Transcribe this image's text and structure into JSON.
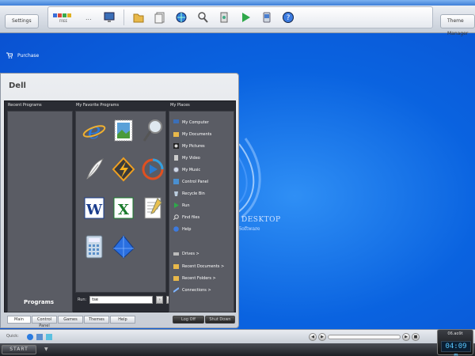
{
  "top": {
    "settings": "Settings",
    "theme_manager": "Theme Manager",
    "dots": "...",
    "tray_caption": "FREE"
  },
  "purchase": "Purchase",
  "desktop": {
    "logo_title": "DESKTOP",
    "logo_sub": "Software"
  },
  "menu": {
    "title": "Dell",
    "recent_header": "Recent Programs",
    "fav_header": "My Favorite Programs",
    "places_header": "My Places",
    "programs_label": "Programs",
    "run_label": "Run:",
    "run_value": "tse",
    "run_go": "›",
    "run_more": "…",
    "favorites": [
      "internet-explorer-icon",
      "mail-stamp-icon",
      "search-magnifier-icon",
      "quill-icon",
      "winamp-icon",
      "media-player-icon",
      "word-icon",
      "excel-icon",
      "notepad-icon",
      "calculator-icon",
      "crystal-icon"
    ],
    "places": [
      {
        "label": "My Computer",
        "icon": "computer-icon"
      },
      {
        "label": "My Documents",
        "icon": "folder-icon"
      },
      {
        "label": "My Pictures",
        "icon": "pictures-icon"
      },
      {
        "label": "My Video",
        "icon": "video-icon"
      },
      {
        "label": "My Music",
        "icon": "music-icon"
      },
      {
        "label": "Control Panel",
        "icon": "control-panel-icon"
      },
      {
        "label": "Recycle Bin",
        "icon": "recycle-bin-icon"
      },
      {
        "label": "Run",
        "icon": "run-icon"
      },
      {
        "label": "Find files",
        "icon": "find-icon"
      },
      {
        "label": "Help",
        "icon": "help-icon"
      }
    ],
    "places_more": [
      {
        "label": "Drives >",
        "icon": "drives-icon"
      },
      {
        "label": "Recent Documents >",
        "icon": "folder-icon"
      },
      {
        "label": "Recent Folders >",
        "icon": "folder-icon"
      },
      {
        "label": "Connections >",
        "icon": "connections-icon"
      }
    ],
    "tabs": [
      "Main",
      "Control Panel",
      "Games",
      "Themes",
      "Help"
    ],
    "power": [
      "Log Off",
      "Shut Down"
    ]
  },
  "quick": {
    "label": "Quick:"
  },
  "taskbar": {
    "start": "START",
    "arrow": "▼"
  },
  "clock": {
    "date": "06.ao9t",
    "time": "04:09 m"
  }
}
